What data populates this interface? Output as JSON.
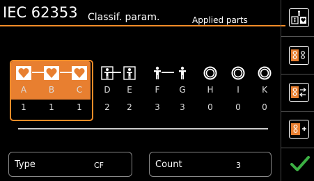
{
  "header": {
    "title": "IEC 62353",
    "tab_classif": "Classif. param.",
    "tab_applied": "Applied parts"
  },
  "parts": [
    {
      "letter": "A",
      "count": "1",
      "icon": "heart-icon"
    },
    {
      "letter": "B",
      "count": "1",
      "icon": "heart-icon"
    },
    {
      "letter": "C",
      "count": "1",
      "icon": "heart-icon"
    },
    {
      "letter": "D",
      "count": "2",
      "icon": "person-box-icon"
    },
    {
      "letter": "E",
      "count": "2",
      "icon": "person-box-icon"
    },
    {
      "letter": "F",
      "count": "3",
      "icon": "person-icon"
    },
    {
      "letter": "G",
      "count": "3",
      "icon": "person-icon"
    },
    {
      "letter": "H",
      "count": "0",
      "icon": "ring-icon"
    },
    {
      "letter": "I",
      "count": "0",
      "icon": "ring-icon"
    },
    {
      "letter": "K",
      "count": "0",
      "icon": "ring-icon"
    }
  ],
  "fields": {
    "type_label": "Type",
    "type_value": "CF",
    "count_label": "Count",
    "count_value": "3"
  },
  "sidebar": [
    "applied-parts-icon",
    "parts-config-icon",
    "parts-swap-icon",
    "parts-add-icon",
    "confirm-check-icon"
  ],
  "colors": {
    "accent": "#f28c28",
    "check": "#3cb043"
  }
}
